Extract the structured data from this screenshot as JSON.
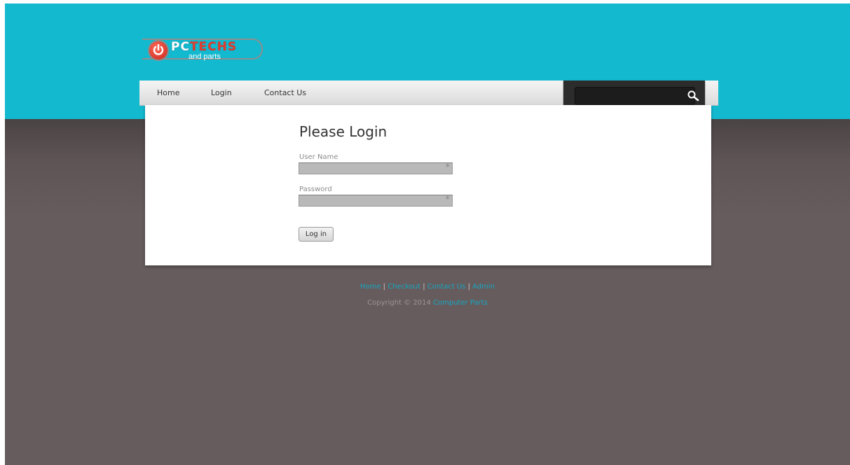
{
  "logo": {
    "brand_primary": "PC",
    "brand_accent": "TECHS",
    "brand_sub": "and parts"
  },
  "nav": {
    "home": "Home",
    "login": "Login",
    "contact": "Contact Us"
  },
  "search": {
    "placeholder": ""
  },
  "login": {
    "title": "Please Login",
    "username_label": "User Name",
    "password_label": "Password",
    "required_marker": "*",
    "button_label": "Log in"
  },
  "footer": {
    "links": [
      "Home",
      "Checkout",
      "Contact Us",
      "Admin"
    ],
    "separator": "|",
    "copyright_prefix": "Copyright © 2014",
    "copyright_link": "Computer Parts"
  },
  "colors": {
    "header_bg": "#12b9cf",
    "body_bg": "#675c5d",
    "link": "#14a7c2",
    "logo_red": "#e23b2e"
  }
}
